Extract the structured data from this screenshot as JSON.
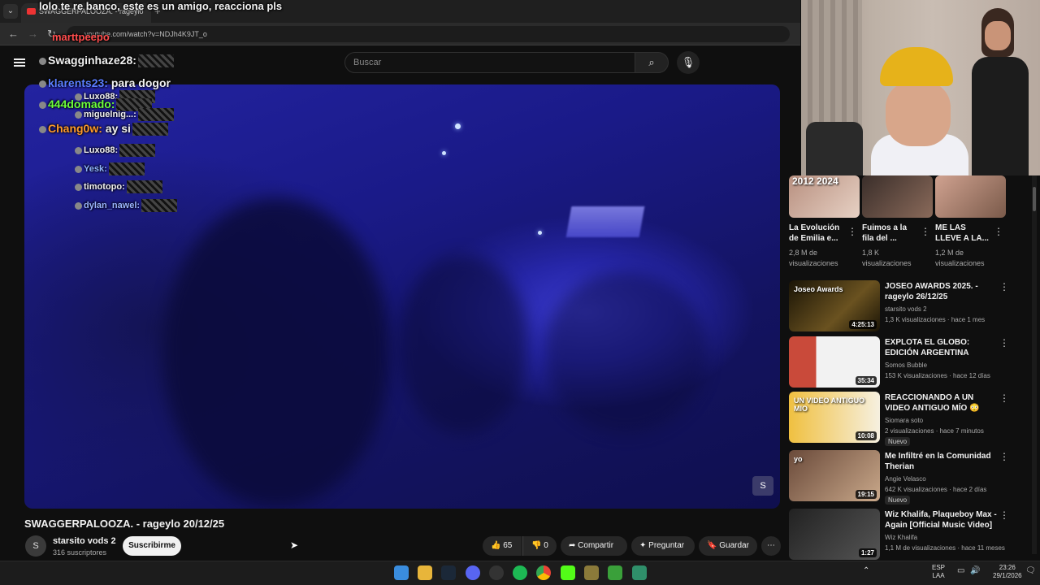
{
  "browser": {
    "tab_title": "SWAGGERPALOOZA. - rageylo",
    "url": "youtube.com/watch?v=NDJh4K9JT_o"
  },
  "header": {
    "search_placeholder": "Buscar"
  },
  "video": {
    "title": "SWAGGERPALOOZA. - rageylo 20/12/25",
    "channel": "starsito vods 2",
    "channel_initial": "S",
    "subscribers": "316 suscriptores",
    "subscribe_label": "Suscribirme",
    "likes": "65",
    "dislikes": "0",
    "share_label": "Compartir",
    "ask_label": "Preguntar",
    "save_label": "Guardar",
    "corner_badge": "S"
  },
  "overlay": {
    "top_message": "lolo te re banco, este es un amigo, reacciona pls",
    "top_user_partial": "marttpeepo",
    "chat": [
      {
        "user": "Swagginhaze28:",
        "text": "",
        "color": "#f1f1f1",
        "emote": true
      },
      {
        "user": "klarents23:",
        "text": "para dogor",
        "color": "#5a7dff",
        "emote": false
      },
      {
        "user": "Luxo88:",
        "text": "",
        "color": "#f1f1f1",
        "emote": true
      },
      {
        "user": "444domado:",
        "text": "",
        "color": "#6cff3a",
        "emote": true
      },
      {
        "user": "miguelnig...:",
        "text": "",
        "color": "#f1f1f1",
        "emote": true
      },
      {
        "user": "Chang0w:",
        "text": "ay si",
        "color": "#ff9a2a",
        "emote": true
      },
      {
        "user": "Luxo88:",
        "text": "",
        "color": "#f1f1f1",
        "emote": true
      },
      {
        "user": "Yesk:",
        "text": "",
        "color": "#8fb4ff",
        "emote": true
      },
      {
        "user": "timotopo:",
        "text": "",
        "color": "#f1f1f1",
        "emote": true
      },
      {
        "user": "dylan_nawel:",
        "text": "",
        "color": "#9ab4ff",
        "emote": true
      }
    ]
  },
  "sidebar": {
    "top_cards": [
      {
        "title": "La Evolución de Emilia e...",
        "meta": "2,8 M de visualizaciones",
        "thumb_text": "2012 2024"
      },
      {
        "title": "Fuimos a la fila del ...",
        "meta": "1,8 K visualizaciones",
        "thumb_text": ""
      },
      {
        "title": "ME LAS LLEVE A LA...",
        "meta": "1,2 M de visualizaciones",
        "thumb_text": ""
      }
    ],
    "items": [
      {
        "title": "JOSEO AWARDS 2025. - rageylo 26/12/25",
        "channel": "starsito vods 2",
        "meta": "1,3 K visualizaciones · hace 1 mes",
        "duration": "4:25:13",
        "new": "",
        "thumb_text": "Joseo Awards"
      },
      {
        "title": "EXPLOTA EL GLOBO: EDICIÓN ARGENTINA",
        "channel": "Somos Bubble",
        "meta": "153 K visualizaciones · hace 12 días",
        "duration": "35:34",
        "new": "",
        "thumb_text": ""
      },
      {
        "title": "REACCIONANDO A UN VIDEO ANTIGUO MÍO 😳",
        "channel": "Siomara soto",
        "meta": "2 visualizaciones · hace 7 minutos",
        "duration": "10:08",
        "new": "Nuevo",
        "thumb_text": "UN VIDEO ANTIGUO MIO"
      },
      {
        "title": "Me Infiltré en la Comunidad Therian",
        "channel": "Angie Velasco",
        "meta": "642 K visualizaciones · hace 2 días",
        "duration": "19:15",
        "new": "Nuevo",
        "thumb_text": "yo"
      },
      {
        "title": "Wiz Khalifa, Plaqueboy Max - Again [Official Music Video]",
        "channel": "Wiz Khalifa",
        "meta": "1,1 M de visualizaciones · hace 11 meses",
        "duration": "1:27",
        "new": "",
        "thumb_text": ""
      }
    ]
  },
  "taskbar": {
    "lang1": "ESP",
    "lang2": "LAA",
    "time": "23:26",
    "date": "29/1/2026"
  },
  "colors": {
    "youtube_red": "#ff0033",
    "spotify_green": "#1db954"
  }
}
